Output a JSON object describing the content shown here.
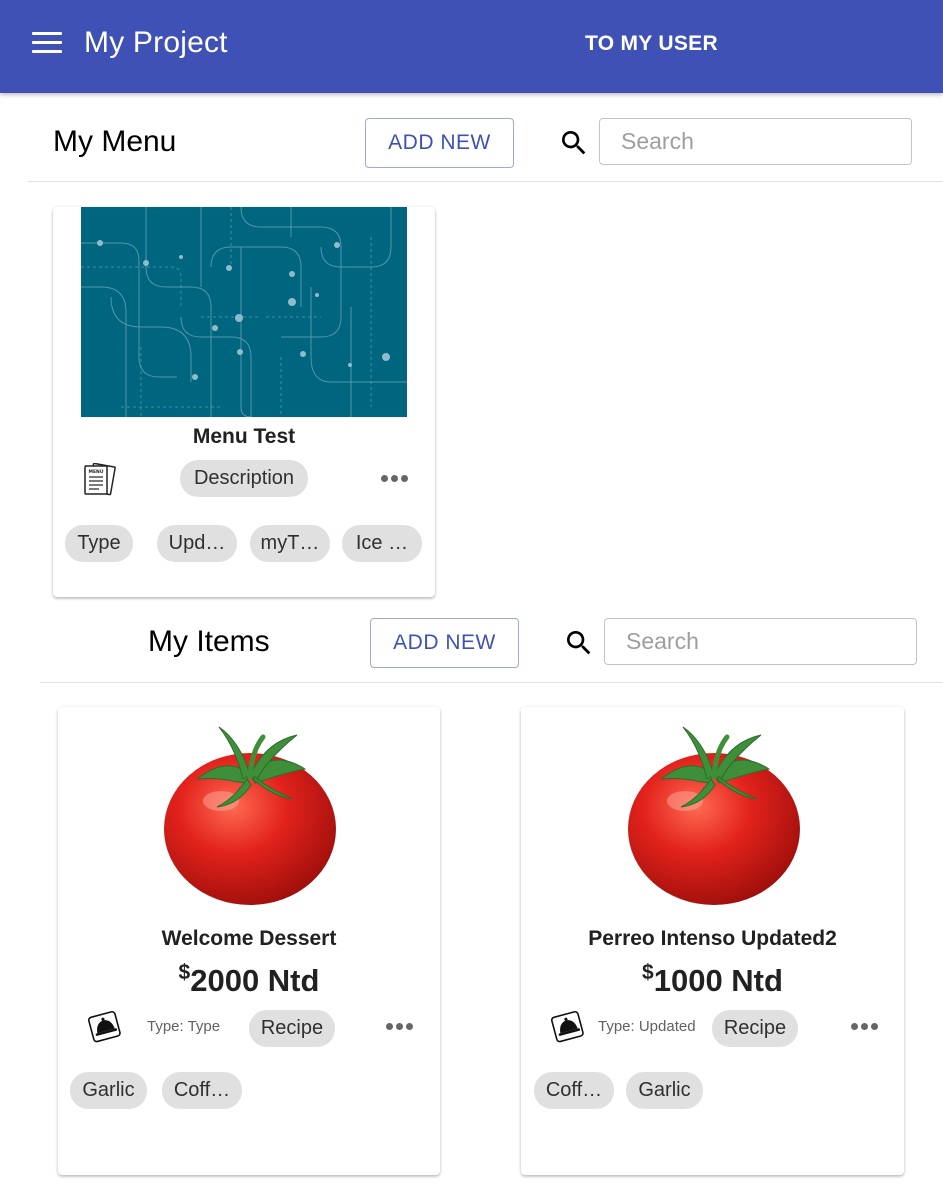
{
  "appbar": {
    "title": "My Project",
    "user_button": "TO MY USER",
    "menu_icon": "hamburger-menu-icon"
  },
  "colors": {
    "primary": "#3f51b5",
    "chip": "#e0e0e0",
    "menu_image_bg": "#006680",
    "tomato": "#e2221c"
  },
  "menu_section": {
    "title": "My Menu",
    "add_label": "ADD NEW",
    "search_placeholder": "Search",
    "search_value": "",
    "cards": [
      {
        "title": "Menu Test",
        "icon": "menu-document-icon",
        "description_chip": "Description",
        "tags": [
          "Type",
          "Upd…",
          "myT…",
          "Ice …"
        ]
      }
    ]
  },
  "items_section": {
    "title": "My Items",
    "add_label": "ADD NEW",
    "search_placeholder": "Search",
    "search_value": "",
    "cards": [
      {
        "title": "Welcome Dessert",
        "currency": "$",
        "price": "2000 Ntd",
        "icon": "dish-cloche-icon",
        "type_text": "Type: Type",
        "recipe_chip": "Recipe",
        "tags": [
          "Garlic",
          "Coff…"
        ]
      },
      {
        "title": "Perreo Intenso Updated2",
        "currency": "$",
        "price": "1000 Ntd",
        "icon": "dish-cloche-icon",
        "type_text": "Type: Updated",
        "recipe_chip": "Recipe",
        "tags": [
          "Coff…",
          "Garlic"
        ]
      }
    ]
  }
}
